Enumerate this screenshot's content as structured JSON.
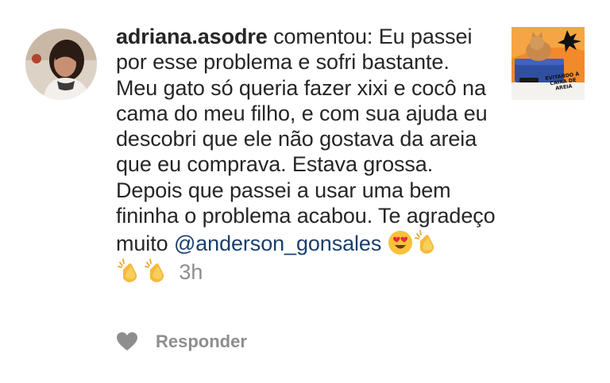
{
  "comment": {
    "username": "adriana.asodre",
    "verb": "comentou:",
    "text": "Eu passei por esse problema e sofri bastante. Meu gato só queria fazer xixi e cocô na cama do meu filho, e com sua ajuda eu descobri que ele não gostava da areia que eu comprava. Estava grossa. Depois que passei a usar uma bem fininha o problema acabou. Te agradeço muito",
    "mention": "@anderson_gonsales",
    "emojis": [
      "heart-eyes-face",
      "clapping-hands",
      "clapping-hands",
      "clapping-hands"
    ],
    "timestamp": "3h"
  },
  "thumbnail": {
    "caption": "EVITANDO À CAIXA DE AREIA"
  },
  "actions": {
    "reply_label": "Responder"
  },
  "colors": {
    "text": "#262626",
    "mention": "#1b3f6b",
    "muted": "#8e8e8e",
    "thumb_orange": "#f28a2b",
    "thumb_blue": "#2f4fa0"
  }
}
